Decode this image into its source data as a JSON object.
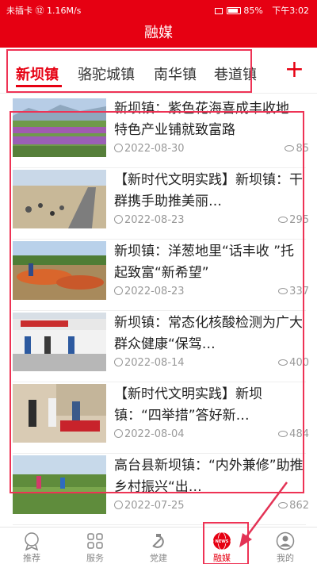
{
  "statusbar": {
    "left": "未插卡 ⑫ 1.16M/s",
    "battery": "85%",
    "time": "下午3:02"
  },
  "header": {
    "title": "融媒"
  },
  "tabs": [
    {
      "label": "新坝镇",
      "active": true
    },
    {
      "label": "骆驼城镇",
      "active": false
    },
    {
      "label": "南华镇",
      "active": false
    },
    {
      "label": "巷道镇",
      "active": false
    }
  ],
  "add_tab_icon": "plus-icon",
  "news": [
    {
      "title": "新坝镇：紫色花海喜成丰收地 特色产业铺就致富路",
      "date": "2022-08-30",
      "views": "85"
    },
    {
      "title": "【新时代文明实践】新坝镇：干群携手助推美丽…",
      "date": "2022-08-23",
      "views": "295"
    },
    {
      "title": "新坝镇：洋葱地里“话丰收 ”托起致富“新希望”",
      "date": "2022-08-23",
      "views": "337"
    },
    {
      "title": "新坝镇：常态化核酸检测为广大群众健康“保驾…",
      "date": "2022-08-14",
      "views": "400"
    },
    {
      "title": "【新时代文明实践】新坝镇：“四举措”答好新…",
      "date": "2022-08-04",
      "views": "484"
    },
    {
      "title": "高台县新坝镇：“内外兼修”助推乡村振兴“出…",
      "date": "2022-07-25",
      "views": "862"
    }
  ],
  "bottom_nav": [
    {
      "label": "推荐",
      "icon": "recommend-icon",
      "active": false
    },
    {
      "label": "服务",
      "icon": "services-icon",
      "active": false
    },
    {
      "label": "党建",
      "icon": "party-icon",
      "active": false
    },
    {
      "label": "融媒",
      "icon": "news-icon",
      "active": true,
      "icon_text": "NEWS"
    },
    {
      "label": "我的",
      "icon": "profile-icon",
      "active": false
    }
  ],
  "colors": {
    "brand": "#e60012",
    "annotation": "#e33355"
  }
}
